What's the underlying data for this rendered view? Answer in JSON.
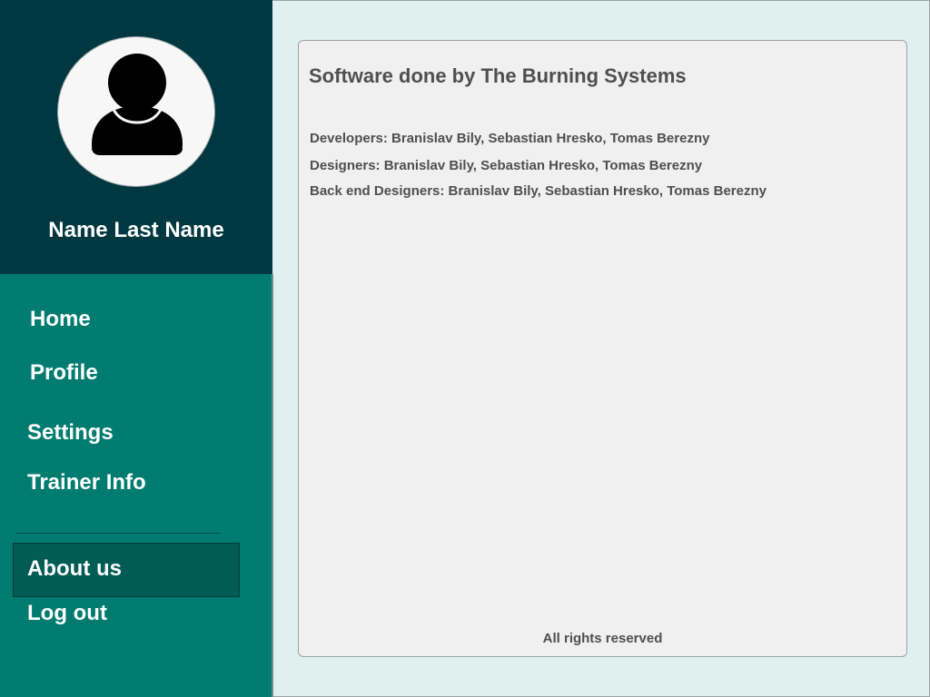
{
  "profile": {
    "avatar_icon": "user-silhouette-icon",
    "name": "Name Last Name"
  },
  "nav": {
    "home": "Home",
    "profile": "Profile",
    "settings": "Settings",
    "trainer_info": "Trainer Info",
    "about_us": "About us",
    "log_out": "Log out",
    "active": "about_us"
  },
  "content": {
    "title": "Software done by The Burning Systems",
    "credits": [
      "Developers: Branislav Bily, Sebastian Hresko, Tomas Berezny",
      "Designers: Branislav Bily, Sebastian Hresko, Tomas Berezny",
      "Back end Designers: Branislav Bily, Sebastian Hresko, Tomas Berezny"
    ],
    "footer": "All rights reserved"
  },
  "colors": {
    "sidebar": "#007b70",
    "header": "#003841",
    "active_item": "#005c54",
    "background": "#dff0ef",
    "card": "#f0f0f0",
    "text": "#4f4f4f"
  }
}
